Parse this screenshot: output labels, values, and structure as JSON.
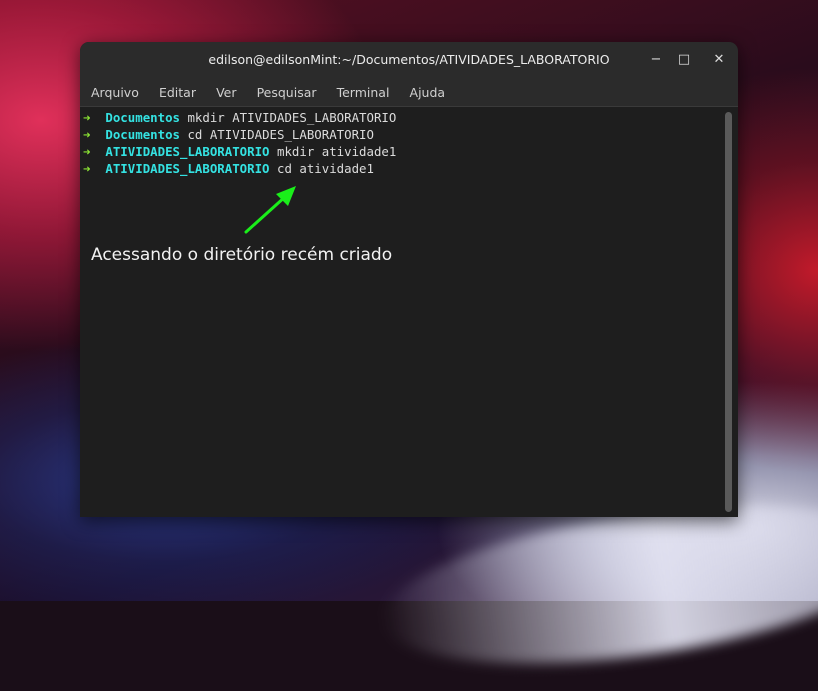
{
  "window": {
    "title": "edilson@edilsonMint:~/Documentos/ATIVIDADES_LABORATORIO",
    "minimize_label": "−",
    "maximize_label": "□",
    "close_label": "✕"
  },
  "menu": {
    "items": [
      {
        "label": "Arquivo"
      },
      {
        "label": "Editar"
      },
      {
        "label": "Ver"
      },
      {
        "label": "Pesquisar"
      },
      {
        "label": "Terminal"
      },
      {
        "label": "Ajuda"
      }
    ]
  },
  "terminal": {
    "prompt_arrow": "➜",
    "lines": [
      {
        "dir": "Documentos",
        "command": "mkdir ATIVIDADES_LABORATORIO"
      },
      {
        "dir": "Documentos",
        "command": "cd ATIVIDADES_LABORATORIO"
      },
      {
        "dir": "ATIVIDADES_LABORATORIO",
        "command": "mkdir atividade1"
      },
      {
        "dir": "ATIVIDADES_LABORATORIO",
        "command": "cd atividade1"
      }
    ]
  },
  "annotation": {
    "text": "Acessando o diretório recém criado",
    "arrow_color": "#1aef1a"
  },
  "colors": {
    "prompt_arrow": "#8ae234",
    "directory": "#34e2e2",
    "terminal_bg": "#1e1e1e",
    "titlebar_bg": "#2b2b2b"
  }
}
